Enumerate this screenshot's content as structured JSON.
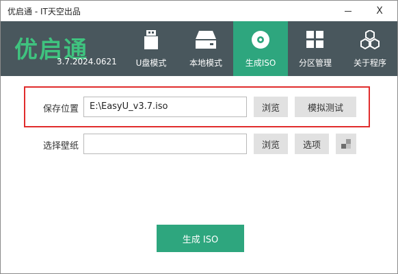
{
  "window": {
    "title": "优启通 - IT天空出品",
    "minimize_glyph": "",
    "close_glyph": "X"
  },
  "header": {
    "logo_text": "优启通",
    "version": "3.7.2024.0621",
    "tabs": [
      {
        "label": "U盘模式",
        "icon": "usb-drive-icon",
        "active": false
      },
      {
        "label": "本地模式",
        "icon": "hard-disk-icon",
        "active": false
      },
      {
        "label": "生成ISO",
        "icon": "disc-icon",
        "active": true
      },
      {
        "label": "分区管理",
        "icon": "grid-icon",
        "active": false
      },
      {
        "label": "关于程序",
        "icon": "hexagon-cluster-icon",
        "active": false
      }
    ]
  },
  "form": {
    "save_location_label": "保存位置",
    "save_location_value": "E:\\EasyU_v3.7.iso",
    "browse_label": "浏览",
    "simulate_label": "模拟测试",
    "wallpaper_label": "选择壁纸",
    "wallpaper_value": "",
    "browse2_label": "浏览",
    "options_label": "选项",
    "preview_icon": "checker-icon"
  },
  "actions": {
    "generate_label": "生成 ISO"
  },
  "colors": {
    "header_bg": "#49575d",
    "accent": "#2ea67e",
    "logo_green": "#3fc37f",
    "highlight_border": "#e02b2b"
  }
}
